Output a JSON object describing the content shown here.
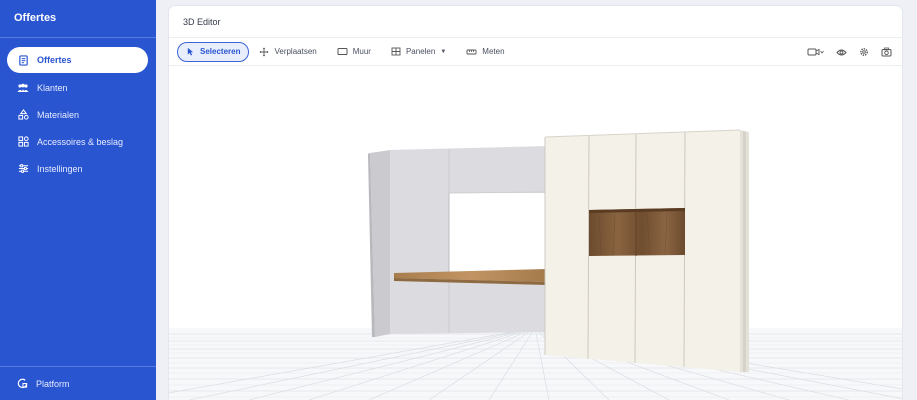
{
  "sidebar": {
    "title": "Offertes",
    "items": [
      {
        "label": "Offertes",
        "icon": "document-icon",
        "active": true
      },
      {
        "label": "Klanten",
        "icon": "users-icon",
        "active": false
      },
      {
        "label": "Materialen",
        "icon": "shapes-icon",
        "active": false
      },
      {
        "label": "Accessoires & beslag",
        "icon": "grid-icon",
        "active": false
      },
      {
        "label": "Instellingen",
        "icon": "sliders-icon",
        "active": false
      }
    ],
    "footer": {
      "label": "Platform",
      "icon": "platform-icon"
    }
  },
  "panel": {
    "title": "3D Editor"
  },
  "toolbar": {
    "tools": [
      {
        "label": "Selecteren",
        "icon": "cursor-icon",
        "active": true
      },
      {
        "label": "Verplaatsen",
        "icon": "move-icon",
        "active": false
      },
      {
        "label": "Muur",
        "icon": "wall-icon",
        "active": false
      },
      {
        "label": "Panelen",
        "icon": "panels-icon",
        "active": false,
        "dropdown": true
      },
      {
        "label": "Meten",
        "icon": "ruler-icon",
        "active": false
      }
    ],
    "right_icons": [
      "camera-icon",
      "eye-icon",
      "settings-icon",
      "screenshot-icon"
    ]
  },
  "colors": {
    "sidebar_bg": "#2a55d1",
    "accent": "#3d64d8",
    "cabinet": "#f4f1e8",
    "wood": "#7a5534",
    "wall": "#d9d8dc"
  }
}
